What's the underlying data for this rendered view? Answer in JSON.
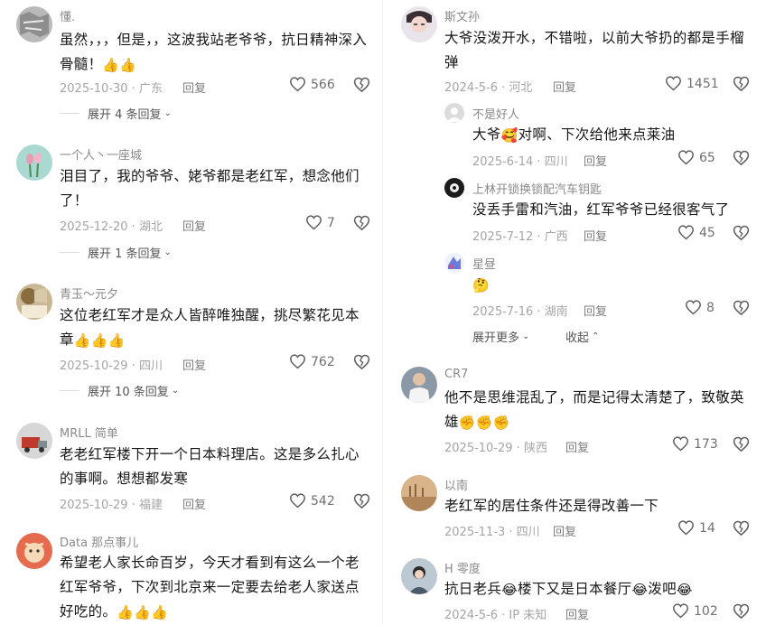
{
  "left": [
    {
      "name": "懂.",
      "text": "虽然，，，但是，，这波我站老爷爷，抗日精神深入骨髓！",
      "emoji": "👍👍",
      "date": "2025-10-30 · 广东",
      "reply": "回复",
      "likes": "566",
      "expand": "展开 4 条回复"
    },
    {
      "name": "一个人丶一座城",
      "text": "泪目了，我的爷爷、姥爷都是老红军，想念他们了！",
      "emoji": "",
      "date": "2025-12-20 · 湖北",
      "reply": "回复",
      "likes": "7",
      "expand": "展开 1 条回复"
    },
    {
      "name": "青玉～元夕",
      "text": "这位老红军才是众人皆醉唯独醒，挑尽繁花见本章",
      "emoji": "👍👍👍",
      "date": "2025-10-29 · 四川",
      "reply": "回复",
      "likes": "762",
      "expand": "展开 10 条回复"
    },
    {
      "name": "MRLL 简单",
      "text": "老老红军楼下开一个日本料理店。这是多么扎心的事啊。想想都发寒",
      "emoji": "",
      "date": "2025-10-29 · 福建",
      "reply": "回复",
      "likes": "542",
      "expand": ""
    },
    {
      "name": "Data 那点事儿",
      "text": "希望老人家长命百岁，今天才看到有这么一个老红军爷爷，下次到北京来一定要去给老人家送点好吃的。",
      "emoji": "👍👍👍",
      "date": "",
      "reply": "",
      "likes": "",
      "expand": ""
    }
  ],
  "right": {
    "main": {
      "name": "斯文孙",
      "text": "大爷没泼开水，不错啦，以前大爷扔的都是手榴弹",
      "date": "2024-5-6 · 河北",
      "reply": "回复",
      "likes": "1451"
    },
    "subs": [
      {
        "name": "不是好人",
        "text_a": "大爷",
        "emoji": "🥰",
        "text_b": "对啊、下次给他来点莱油",
        "date": "2025-6-14 · 四川",
        "reply": "回复",
        "likes": "65"
      },
      {
        "name": "上林开锁换锁配汽车钥匙",
        "text_a": "没丢手雷和汽油，红军爷爷已经很客气了",
        "emoji": "",
        "text_b": "",
        "date": "2025-7-12 · 广西",
        "reply": "回复",
        "likes": "45"
      },
      {
        "name": "星昼",
        "text_a": "",
        "emoji": "🤔",
        "text_b": "",
        "date": "2025-7-16 · 湖南",
        "reply": "回复",
        "likes": "8"
      }
    ],
    "more": "展开更多",
    "collapse": "收起",
    "others": [
      {
        "name": "CR7",
        "text": "他不是思维混乱了，而是记得太清楚了，致敬英雄",
        "emoji": "✊✊✊",
        "date": "2025-10-29 · 陕西",
        "reply": "回复",
        "likes": "173"
      },
      {
        "name": "以南",
        "text": "老红军的居住条件还是得改善一下",
        "emoji": "",
        "date": "2025-11-3 · 四川",
        "reply": "回复",
        "likes": "14"
      },
      {
        "name": "H 零度",
        "text_a": "抗日老兵",
        "emoji_a": "😂",
        "text_b": "楼下又是日本餐厅",
        "emoji_b": "😂",
        "text_c": "泼吧",
        "emoji_c": "😂",
        "date": "2024-5-6 · IP 未知",
        "reply": "回复",
        "likes": "102"
      }
    ]
  }
}
